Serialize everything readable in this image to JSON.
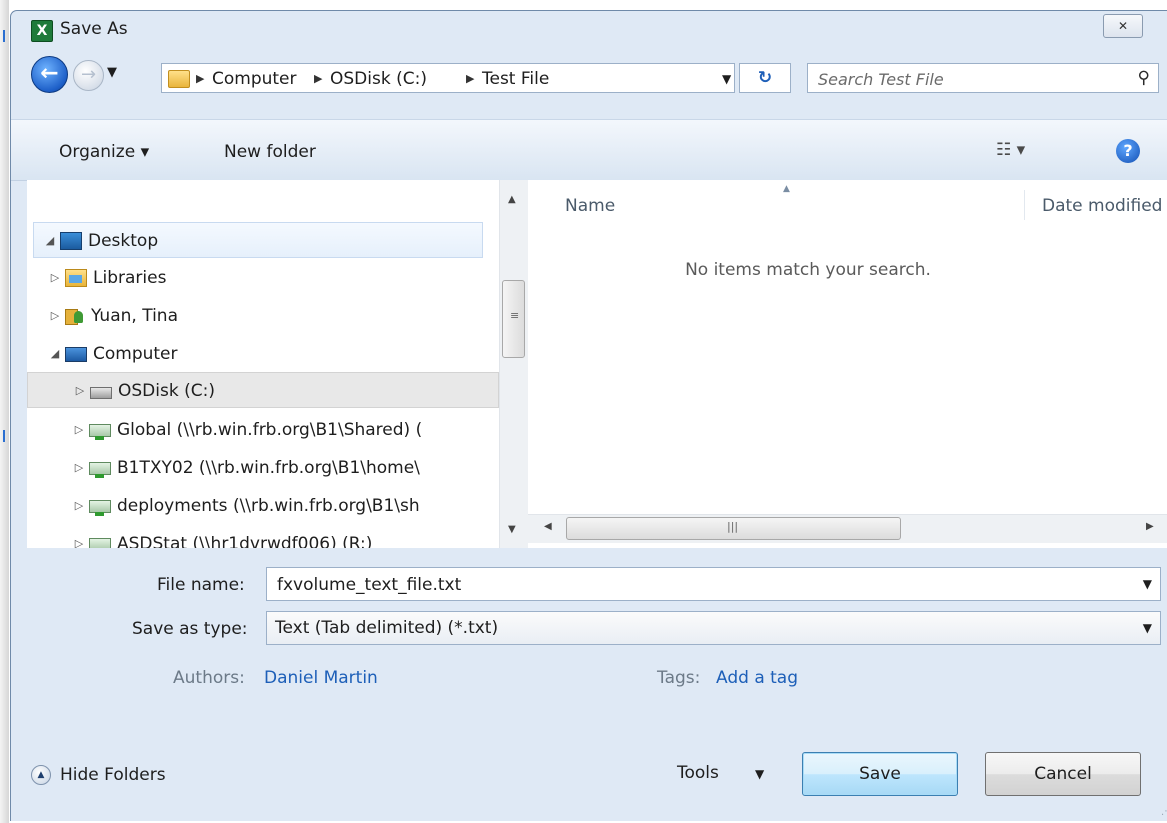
{
  "window": {
    "app_icon": "X",
    "title": "Save As",
    "close_glyph": "✕"
  },
  "navigation": {
    "back_icon": "arrow-left-icon",
    "forward_icon": "arrow-right-icon",
    "breadcrumbs": [
      "Computer",
      "OSDisk (C:)",
      "Test File"
    ],
    "search_placeholder": "Search Test File"
  },
  "toolbar": {
    "organize_label": "Organize ▾",
    "new_folder_label": "New folder",
    "views_glyph": "☷ ▾",
    "help_glyph": "?"
  },
  "tree": {
    "items": [
      {
        "label": "Desktop",
        "expander": "◢",
        "icon": "desktop-icon"
      },
      {
        "label": "Libraries",
        "expander": "▷",
        "icon": "libraries-icon"
      },
      {
        "label": "Yuan, Tina",
        "expander": "▷",
        "icon": "user-folder-icon"
      },
      {
        "label": "Computer",
        "expander": "◢",
        "icon": "computer-icon"
      },
      {
        "label": "OSDisk (C:)",
        "expander": "▷",
        "icon": "drive-icon"
      },
      {
        "label": "Global (\\\\rb.win.frb.org\\B1\\Shared) (",
        "expander": "▷",
        "icon": "network-drive-icon"
      },
      {
        "label": "B1TXY02 (\\\\rb.win.frb.org\\B1\\home\\",
        "expander": "▷",
        "icon": "network-drive-icon"
      },
      {
        "label": "deployments (\\\\rb.win.frb.org\\B1\\sh",
        "expander": "▷",
        "icon": "network-drive-icon"
      },
      {
        "label": "ASDStat (\\\\hr1dvrwdf006) (R:)",
        "expander": "▷",
        "icon": "network-drive-icon"
      }
    ]
  },
  "list": {
    "columns": [
      "Name",
      "Date modified"
    ],
    "empty_message": "No items match your search."
  },
  "form": {
    "file_name_label": "File name:",
    "file_name_value": "fxvolume_text_file.txt",
    "save_type_label": "Save as type:",
    "save_type_value": "Text (Tab delimited) (*.txt)",
    "authors_label": "Authors:",
    "authors_value": "Daniel Martin",
    "tags_label": "Tags:",
    "tags_value": "Add a tag"
  },
  "footer": {
    "hide_folders_label": "Hide Folders",
    "tools_label": "Tools",
    "save_label": "Save",
    "cancel_label": "Cancel"
  }
}
